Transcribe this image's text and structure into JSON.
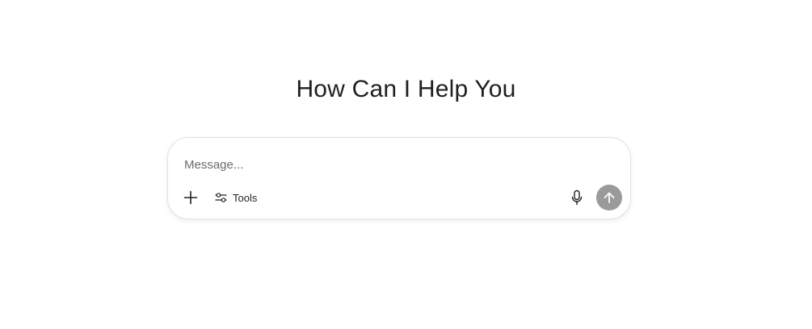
{
  "heading": "How Can I Help You",
  "composer": {
    "placeholder": "Message...",
    "value": "",
    "add_icon": "plus-icon",
    "tools": {
      "label": "Tools",
      "icon": "sliders-icon"
    },
    "mic_icon": "microphone-icon",
    "send_icon": "arrow-up-icon"
  },
  "colors": {
    "send_button_bg": "#9a9a9a",
    "border": "#e3e3e3",
    "text": "#1f1f1f",
    "placeholder": "#6b6b6b"
  }
}
